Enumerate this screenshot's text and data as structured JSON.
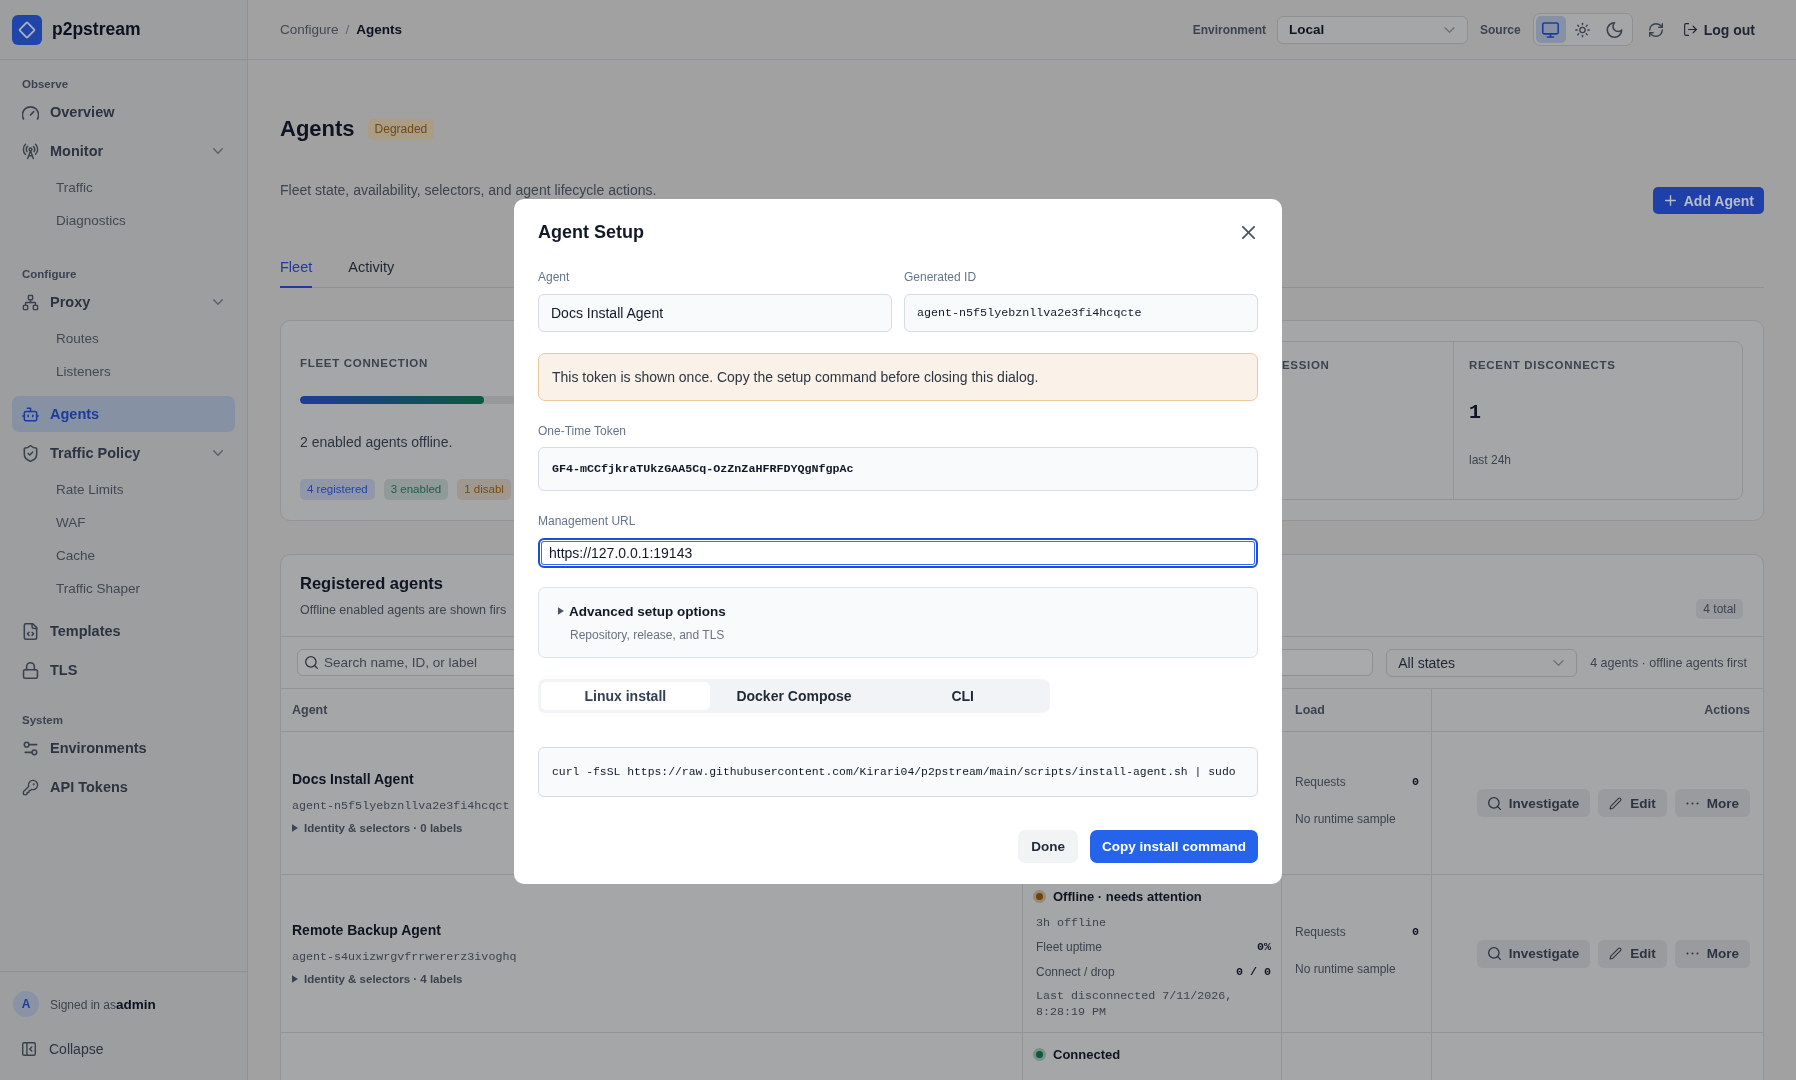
{
  "sidebar": {
    "brand": "p2pstream",
    "sections": [
      {
        "title": "Observe",
        "items": [
          {
            "label": "Overview",
            "selected": false
          },
          {
            "label": "Monitor",
            "selected": false,
            "expanded": true,
            "children": [
              {
                "label": "Traffic",
                "selected": false
              },
              {
                "label": "Diagnostics",
                "selected": false
              }
            ]
          }
        ]
      },
      {
        "title": "Configure",
        "items": [
          {
            "label": "Proxy",
            "selected": false,
            "expanded": true,
            "children": [
              {
                "label": "Routes",
                "selected": false
              },
              {
                "label": "Listeners",
                "selected": false
              }
            ]
          },
          {
            "label": "Agents",
            "selected": true
          },
          {
            "label": "Traffic Policy",
            "selected": false,
            "expanded": true,
            "children": [
              {
                "label": "Rate Limits",
                "selected": false
              },
              {
                "label": "WAF",
                "selected": false
              },
              {
                "label": "Cache",
                "selected": false
              },
              {
                "label": "Traffic Shaper",
                "selected": false
              }
            ]
          },
          {
            "label": "Templates",
            "selected": false
          },
          {
            "label": "TLS",
            "selected": false
          }
        ]
      },
      {
        "title": "System",
        "items": [
          {
            "label": "Environments",
            "selected": false
          },
          {
            "label": "API Tokens",
            "selected": false
          }
        ]
      }
    ],
    "user": {
      "initial": "A",
      "signed_in": "Signed in as**admin**"
    },
    "collapse": "Collapse"
  },
  "topbar": {
    "breadcrumb": {
      "items": [
        "Configure",
        "Agents"
      ],
      "separator": "/"
    },
    "environment": {
      "label": "Environment",
      "value": "Local"
    },
    "source": {
      "label": "Source",
      "options": [
        {
          "selected": true
        },
        {
          "selected": false
        },
        {
          "selected": false
        }
      ]
    },
    "logout": "Log out"
  },
  "page": {
    "title": "Agents",
    "status": "Degraded",
    "subtitle": "Fleet state, availability, selectors, and agent lifecycle actions.",
    "add_button": "Add Agent",
    "tabs": [
      {
        "label": "Fleet",
        "selected": true
      },
      {
        "label": "Activity",
        "selected": false
      }
    ]
  },
  "fleet": {
    "connection": {
      "label": "FLEET CONNECTION",
      "level": 0.5,
      "summary": "2 enabled agents offline.",
      "chips": [
        {
          "label": "4 registered",
          "color": "#2443a5"
        },
        {
          "label": "3 enabled",
          "color": "#1d5e46"
        },
        {
          "label": "1 disabl",
          "color": "#7a4a12"
        }
      ]
    },
    "stats": [
      {
        "label": "ESSION"
      },
      {
        "label": "RECENT DISCONNECTS",
        "value": "1",
        "caption": "last 24h"
      }
    ]
  },
  "agents": {
    "title": "Registered agents",
    "subtitle": "Offline enabled agents are shown firs",
    "total": "4 total",
    "search": {
      "placeholder": "Search name, ID, or label"
    },
    "state_filter": "All states",
    "count": "4 agents · offline agents first",
    "columns": [
      "Agent",
      "Load",
      "Actions"
    ],
    "rows": [
      {
        "name": "Docs Install Agent",
        "id": "agent-n5f5lyebznllva2e3fi4hcqct",
        "identity": {
          "label": "Identity & selectors · 0 labels",
          "expanded": false
        },
        "load": {
          "label": "Requests",
          "value": "0",
          "note": "No runtime sample"
        },
        "actions": [
          "Investigate",
          "Edit",
          "More"
        ]
      },
      {
        "name": "Remote Backup Agent",
        "id": "agent-s4uxizwrgvfrrwererz3ivoghq",
        "identity": {
          "label": "Identity & selectors · 4 labels",
          "expanded": false
        },
        "status": {
          "label": "Offline · needs attention",
          "color": "#6e4309",
          "duration": "3h offline",
          "metrics": [
            {
              "label": "Fleet uptime",
              "value": "0%"
            },
            {
              "label": "Connect / drop",
              "value": "0 / 0"
            }
          ],
          "last": "Last disconnected 7/11/2026, 8:28:19 PM"
        },
        "load": {
          "label": "Requests",
          "value": "0",
          "note": "No runtime sample"
        },
        "actions": [
          "Investigate",
          "Edit",
          "More"
        ]
      },
      {
        "status": {
          "label": "Connected",
          "color": "#0b5a3a"
        }
      }
    ]
  },
  "dialog": {
    "title": "Agent Setup",
    "agent": {
      "label": "Agent",
      "value": "Docs Install Agent"
    },
    "generated_id": {
      "label": "Generated ID",
      "value": "agent-n5f5lyebznllva2e3fi4hcqcte"
    },
    "warning": "This token is shown once. Copy the setup command before closing this dialog.",
    "token": {
      "label": "One-Time Token",
      "value": "GF4-mCCfjkraTUkzGAA5Cq-OzZnZaHFRFDYQgNfgpAc"
    },
    "management_url": {
      "label": "Management URL",
      "value": "https://127.0.0.1:19143",
      "focused": true
    },
    "advanced": {
      "label": "Advanced setup options",
      "description": "Repository, release, and TLS",
      "expanded": false
    },
    "methods": [
      {
        "label": "Linux install",
        "selected": true
      },
      {
        "label": "Docker Compose",
        "selected": false
      },
      {
        "label": "CLI",
        "selected": false
      }
    ],
    "command": "curl -fsSL https://raw.githubusercontent.com/Kirari04/p2pstream/main/scripts/install-agent.sh | sudo",
    "buttons": [
      {
        "label": "Done",
        "kind": "secondary"
      },
      {
        "label": "Copy install command",
        "kind": "primary"
      }
    ]
  }
}
